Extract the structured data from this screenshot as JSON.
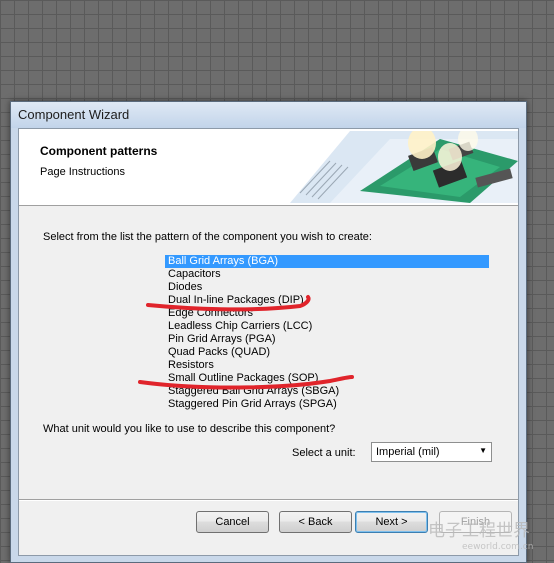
{
  "window": {
    "title": "Component Wizard"
  },
  "header": {
    "title": "Component patterns",
    "subtitle": "Page Instructions"
  },
  "prompt": "Select from the list the pattern of the component you wish to create:",
  "patterns": [
    {
      "label": "Ball Grid Arrays (BGA)",
      "selected": true
    },
    {
      "label": "Capacitors"
    },
    {
      "label": "Diodes"
    },
    {
      "label": "Dual In-line Packages (DIP)"
    },
    {
      "label": "Edge Connectors"
    },
    {
      "label": "Leadless Chip Carriers (LCC)"
    },
    {
      "label": "Pin Grid Arrays (PGA)"
    },
    {
      "label": "Quad Packs (QUAD)"
    },
    {
      "label": "Resistors"
    },
    {
      "label": "Small Outline Packages (SOP)"
    },
    {
      "label": "Staggered Ball Grid Arrays (SBGA)"
    },
    {
      "label": "Staggered Pin Grid Arrays (SPGA)"
    }
  ],
  "unit": {
    "question": "What unit would you like to use to describe this component?",
    "label": "Select a unit:",
    "value": "Imperial (mil)"
  },
  "buttons": {
    "cancel": "Cancel",
    "back": "< Back",
    "next": "Next >",
    "finish": "Finish"
  },
  "watermark": {
    "text": "电子工程世界",
    "sub": "eeworld.com.cn"
  },
  "colors": {
    "selection": "#3399ff",
    "annotation": "#e0242b",
    "banner_board": "#2b9a6a"
  }
}
